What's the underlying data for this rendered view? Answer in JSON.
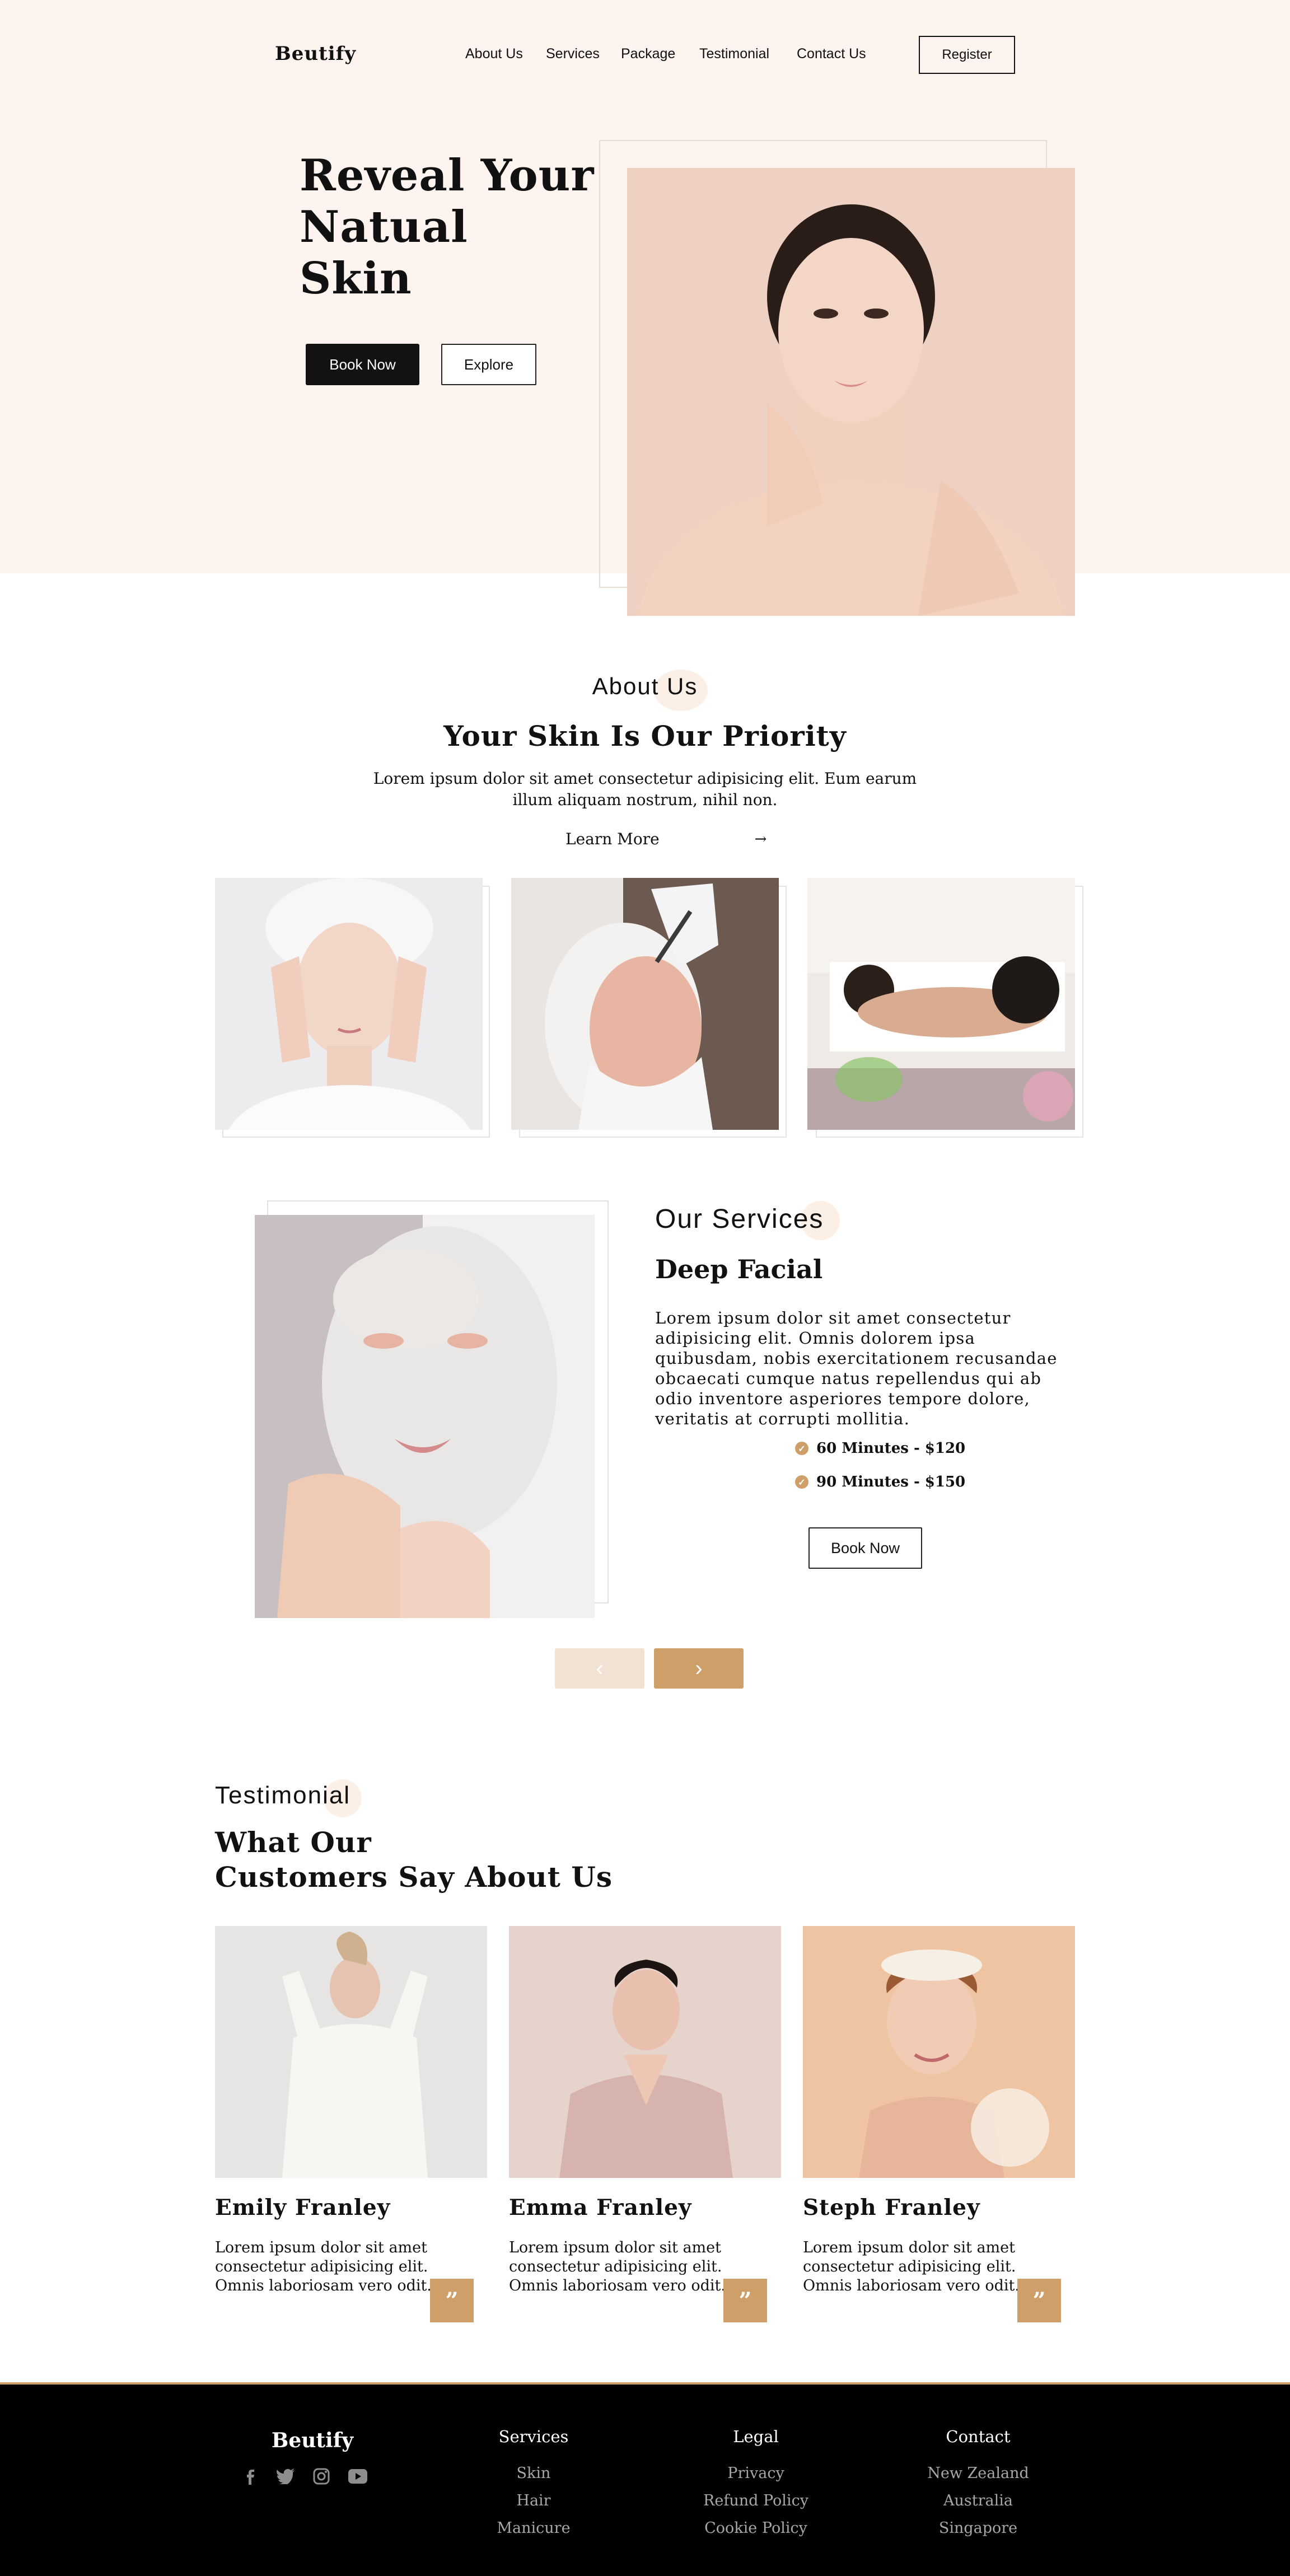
{
  "header": {
    "brand": "Beutify",
    "nav": [
      "About Us",
      "Services",
      "Package",
      "Testimonial",
      "Contact Us"
    ],
    "register_label": "Register"
  },
  "hero": {
    "title_lines": [
      "Reveal Your",
      "Natual",
      "Skin"
    ],
    "book_label": "Book Now",
    "explore_label": "Explore"
  },
  "about": {
    "kicker": "About Us",
    "heading": "Your Skin Is Our Priority",
    "text": "Lorem ipsum dolor sit amet consectetur adipisicing elit. Eum earum illum aliquam nostrum, nihil non.",
    "learn_more": "Learn More"
  },
  "services": {
    "kicker": "Our Services",
    "title": "Deep Facial",
    "description": "Lorem ipsum dolor sit amet consectetur adipisicing elit. Omnis dolorem ipsa quibusdam, nobis exercitationem recusandae obcaecati cumque natus repellendus qui ab odio inventore asperiores tempore dolore, veritatis at corrupti mollitia.",
    "prices": [
      "60 Minutes - $120",
      "90 Minutes - $150"
    ],
    "book_label": "Book Now"
  },
  "testimonial": {
    "kicker": "Testimonial",
    "heading_lines": [
      "What Our",
      "Customers Say About Us"
    ],
    "items": [
      {
        "name": "Emily Franley",
        "text": "Lorem ipsum dolor sit amet consectetur adipisicing elit. Omnis laboriosam vero odit."
      },
      {
        "name": "Emma Franley",
        "text": "Lorem ipsum dolor sit amet consectetur adipisicing elit. Omnis laboriosam vero odit."
      },
      {
        "name": "Steph Franley",
        "text": "Lorem ipsum dolor sit amet consectetur adipisicing elit. Omnis laboriosam vero odit."
      }
    ],
    "quote_glyph": "”"
  },
  "footer": {
    "brand": "Beutify",
    "social": [
      "facebook-icon",
      "twitter-icon",
      "instagram-icon",
      "youtube-icon"
    ],
    "columns": [
      {
        "heading": "Services",
        "links": [
          "Skin",
          "Hair",
          "Manicure"
        ]
      },
      {
        "heading": "Legal",
        "links": [
          "Privacy",
          "Refund Policy",
          "Cookie Policy"
        ]
      },
      {
        "heading": "Contact",
        "links": [
          "New Zealand",
          "Australia",
          "Singapore"
        ]
      }
    ]
  },
  "colors": {
    "hero_bg": "#fdf4ef",
    "accent": "#cf9f69",
    "accent_light": "#f1e2d3",
    "dark": "#121212"
  }
}
